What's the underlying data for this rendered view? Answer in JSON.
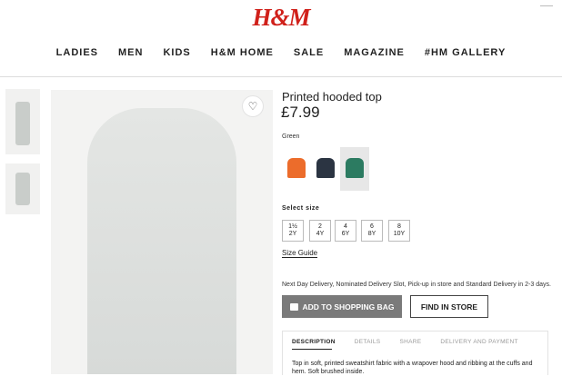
{
  "brand": {
    "logo_text": "H&M"
  },
  "nav": {
    "items": [
      "LADIES",
      "MEN",
      "KIDS",
      "H&M HOME",
      "SALE",
      "MAGAZINE",
      "#HM GALLERY"
    ]
  },
  "product": {
    "title": "Printed hooded top",
    "price": "£7.99",
    "color_label": "Green",
    "swatch_colors": [
      "#ec6c2b",
      "#2b3442",
      "#2c7b61"
    ],
    "size_label": "Select size",
    "sizes": [
      {
        "top": "1½",
        "bottom": "2Y"
      },
      {
        "top": "2",
        "bottom": "4Y"
      },
      {
        "top": "4",
        "bottom": "6Y"
      },
      {
        "top": "6",
        "bottom": "8Y"
      },
      {
        "top": "8",
        "bottom": "10Y"
      }
    ],
    "size_guide": "Size Guide",
    "delivery_text": "Next Day Delivery, Nominated Delivery Slot, Pick-up in store and Standard Delivery in 2-3 days.",
    "add_to_bag": "ADD TO SHOPPING BAG",
    "find_in_store": "FIND IN STORE"
  },
  "description": {
    "tabs": [
      "DESCRIPTION",
      "DETAILS",
      "SHARE",
      "DELIVERY AND PAYMENT"
    ],
    "text": "Top in soft, printed sweatshirt fabric with a wrapover hood and ribbing at the cuffs and hem. Soft brushed inside."
  }
}
